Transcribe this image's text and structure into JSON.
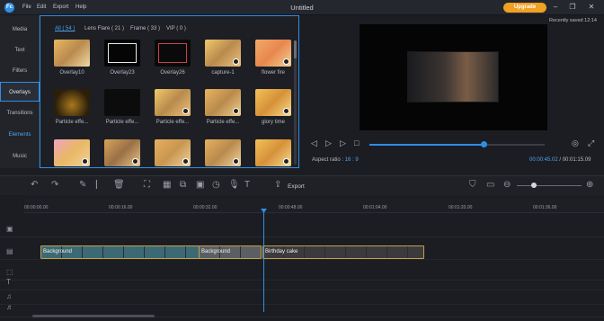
{
  "app": {
    "logo": "Fc",
    "title": "Untitled",
    "upgrade_label": "Upgrade",
    "recently_saved": "Recently saved 12:14"
  },
  "menu": [
    "File",
    "Edit",
    "Export",
    "Help"
  ],
  "sidebar": {
    "items": [
      "Media",
      "Text",
      "Filters",
      "Overlays",
      "Transitions",
      "Elements",
      "Music"
    ],
    "active": "Overlays"
  },
  "filters_tabs": [
    "All ( 54 )",
    "Lens Flare ( 21 )",
    "Frame ( 33 )",
    "VIP ( 0 )"
  ],
  "tiles": [
    {
      "label": "Overlay10",
      "bg": "linear-gradient(135deg,#e8b863,#b98a4d,#f0d9a3)"
    },
    {
      "label": "Overlay23",
      "bg": "#050505"
    },
    {
      "label": "Overlay26",
      "bg": "#0a0a0a"
    },
    {
      "label": "capture-1",
      "bg": "linear-gradient(135deg,#f1c96b,#b98a4d,#e9c27a)"
    },
    {
      "label": "flower fire",
      "bg": "linear-gradient(135deg,#f4a96b,#e6874e,#f5d194)"
    },
    {
      "label": "Particle effe...",
      "bg": "radial-gradient(circle at 50% 60%,#a8791f,#2b1f0a 70%)"
    },
    {
      "label": "Particle effe...",
      "bg": "#0c0c0c"
    },
    {
      "label": "Particle effe...",
      "bg": "linear-gradient(135deg,#f1c96b,#b98a4d,#e9c27a)"
    },
    {
      "label": "Particle effe...",
      "bg": "linear-gradient(135deg,#e9b45f,#b98a4d,#f0cf8a)"
    },
    {
      "label": "glory time",
      "bg": "linear-gradient(135deg,#f3c15a,#d69138,#f6db8f)"
    },
    {
      "label": "",
      "bg": "linear-gradient(135deg,#f2a3c0,#e8b863,#f1d0a0)"
    },
    {
      "label": "",
      "bg": "linear-gradient(135deg,#d8a35a,#9a7046,#e8c487)"
    },
    {
      "label": "",
      "bg": "linear-gradient(135deg,#e6b060,#c99650,#f0d39c)"
    },
    {
      "label": "",
      "bg": "linear-gradient(135deg,#e6b060,#b98a4d,#f0d39c)"
    },
    {
      "label": "",
      "bg": "linear-gradient(135deg,#f3c15a,#d69138,#f6db8f)"
    }
  ],
  "preview": {
    "aspect_label": "Aspect ratio :",
    "aspect_value": "16 : 9",
    "current_time": "00:00:45.02",
    "total_time": "00:01:15.09",
    "progress": 0.65
  },
  "toolbar": {
    "export_label": "Export"
  },
  "ruler": [
    "00:00:00.00",
    "00:00:16.00",
    "00:00:32.00",
    "00:00:48.00",
    "00:01:04.00",
    "00:01:20.00",
    "00:01:36.00"
  ],
  "clips": [
    {
      "label": "Background",
      "color": "#3c6a74"
    },
    {
      "label": "Background",
      "color": "#5b5f63"
    },
    {
      "label": "Birthday cake",
      "color": "#3b3b3e"
    }
  ],
  "colors": {
    "accent": "#2f8ee6",
    "upgrade": "#f0a023",
    "clip_border": "#c5a04a"
  }
}
